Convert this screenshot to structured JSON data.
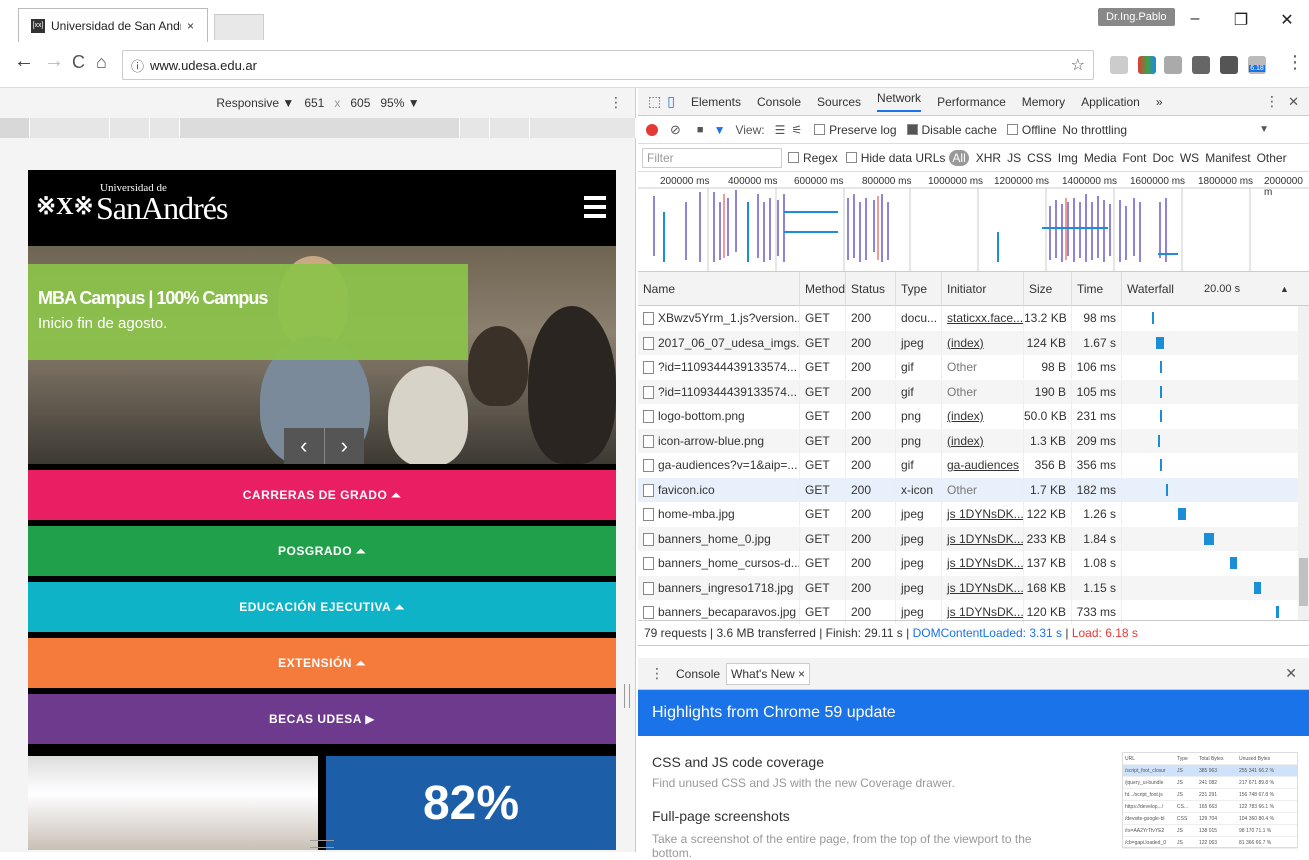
{
  "browser": {
    "tab_title": "Universidad de San Andr",
    "tab_close": "×",
    "favicon_text": "[xx]",
    "user_name": "Dr.Ing.Pablo",
    "win_min": "–",
    "win_max": "❐",
    "win_close": "✕",
    "back": "←",
    "forward": "→",
    "reload": "C",
    "home": "⌂",
    "info_icon": "ⓘ",
    "url": "www.udesa.edu.ar",
    "bookmark": "☆",
    "menu": "⋮",
    "badge": "6.18"
  },
  "emulation": {
    "mode": "Responsive ▼",
    "width": "651",
    "times": "x",
    "height": "605",
    "zoom": "95% ▼",
    "dots": "⋮"
  },
  "site": {
    "logo_small": "Universidad de",
    "logo_big": "SanAndrés",
    "logo_crest": "※X※",
    "hero_title": "MBA Campus | 100% Campus",
    "hero_sub": "Inicio fin de agosto.",
    "prev": "‹",
    "next": "›",
    "menus": [
      {
        "label": "CARRERAS DE GRADO ⏶",
        "color": "#e91e63"
      },
      {
        "label": "POSGRADO ⏶",
        "color": "#21a04b"
      },
      {
        "label": "EDUCACIÓN EJECUTIVA ⏶",
        "color": "#0fb3c8"
      },
      {
        "label": "EXTENSIÓN ⏶",
        "color": "#f47b3b"
      },
      {
        "label": "BECAS UDESA ▶",
        "color": "#6d3a8e"
      }
    ],
    "stat": "82%"
  },
  "devtools": {
    "tabs": [
      "Elements",
      "Console",
      "Sources",
      "Network",
      "Performance",
      "Memory",
      "Application",
      "»"
    ],
    "active_tab": "Network",
    "view_label": "View:",
    "preserve_log": "Preserve log",
    "disable_cache": "Disable cache",
    "offline": "Offline",
    "throttling": "No throttling",
    "filter_placeholder": "Filter",
    "regex": "Regex",
    "hide_data_urls": "Hide data URLs",
    "type_filters": [
      "All",
      "XHR",
      "JS",
      "CSS",
      "Img",
      "Media",
      "Font",
      "Doc",
      "WS",
      "Manifest",
      "Other"
    ],
    "overview_labels": [
      "200000 ms",
      "400000 ms",
      "600000 ms",
      "800000 ms",
      "1000000 ms",
      "1200000 ms",
      "1400000 ms",
      "1600000 ms",
      "1800000 ms",
      "2000000 m"
    ],
    "columns": [
      "Name",
      "Method",
      "Status",
      "Type",
      "Initiator",
      "Size",
      "Time",
      "Waterfall"
    ],
    "waterfall_scale": "20.00 s",
    "rows": [
      {
        "name": "XBwzv5Yrm_1.js?version...",
        "method": "GET",
        "status": "200",
        "type": "docu...",
        "initiator": "staticxx.face...",
        "size": "13.2 KB",
        "time": "98 ms"
      },
      {
        "name": "2017_06_07_udesa_imgs...",
        "method": "GET",
        "status": "200",
        "type": "jpeg",
        "initiator": "(index)",
        "size": "124 KB",
        "time": "1.67 s"
      },
      {
        "name": "?id=1109344439133574...",
        "method": "GET",
        "status": "200",
        "type": "gif",
        "initiator": "Other",
        "size": "98 B",
        "time": "106 ms"
      },
      {
        "name": "?id=1109344439133574...",
        "method": "GET",
        "status": "200",
        "type": "gif",
        "initiator": "Other",
        "size": "190 B",
        "time": "105 ms"
      },
      {
        "name": "logo-bottom.png",
        "method": "GET",
        "status": "200",
        "type": "png",
        "initiator": "(index)",
        "size": "50.0 KB",
        "time": "231 ms"
      },
      {
        "name": "icon-arrow-blue.png",
        "method": "GET",
        "status": "200",
        "type": "png",
        "initiator": "(index)",
        "size": "1.3 KB",
        "time": "209 ms"
      },
      {
        "name": "ga-audiences?v=1&aip=...",
        "method": "GET",
        "status": "200",
        "type": "gif",
        "initiator": "ga-audiences",
        "size": "356 B",
        "time": "356 ms"
      },
      {
        "name": "favicon.ico",
        "method": "GET",
        "status": "200",
        "type": "x-icon",
        "initiator": "Other",
        "size": "1.7 KB",
        "time": "182 ms"
      },
      {
        "name": "home-mba.jpg",
        "method": "GET",
        "status": "200",
        "type": "jpeg",
        "initiator": "js 1DYNsDK...",
        "size": "122 KB",
        "time": "1.26 s"
      },
      {
        "name": "banners_home_0.jpg",
        "method": "GET",
        "status": "200",
        "type": "jpeg",
        "initiator": "js 1DYNsDK...",
        "size": "233 KB",
        "time": "1.84 s"
      },
      {
        "name": "banners_home_cursos-d...",
        "method": "GET",
        "status": "200",
        "type": "jpeg",
        "initiator": "js 1DYNsDK...",
        "size": "137 KB",
        "time": "1.08 s"
      },
      {
        "name": "banners_ingreso1718.jpg",
        "method": "GET",
        "status": "200",
        "type": "jpeg",
        "initiator": "js 1DYNsDK...",
        "size": "168 KB",
        "time": "1.15 s"
      },
      {
        "name": "banners_becaparavos.jpg",
        "method": "GET",
        "status": "200",
        "type": "jpeg",
        "initiator": "js 1DYNsDK...",
        "size": "120 KB",
        "time": "733 ms"
      }
    ],
    "summary_a": "79 requests | 3.6 MB transferred | Finish: 29.11 s | ",
    "summary_dcl": "DOMContentLoaded: 3.31 s",
    "summary_sep": " | ",
    "summary_load": "Load: 6.18 s",
    "drawer_tabs": [
      "Console",
      "What's New ×"
    ],
    "drawer_close": "✕",
    "banner": "Highlights from Chrome 59 update",
    "features": [
      {
        "title": "CSS and JS code coverage",
        "desc": "Find unused CSS and JS with the new Coverage drawer."
      },
      {
        "title": "Full-page screenshots",
        "desc": "Take a screenshot of the entire page, from the top of the viewport to the bottom."
      }
    ],
    "coverage_head": [
      "URL",
      "Type",
      "Total Bytes",
      "Unused Bytes"
    ],
    "coverage_rows": [
      [
        "/script_foot_closur",
        "JS",
        "385 963",
        "255 341 66.2 %"
      ],
      [
        "/jquery_ui-bundle",
        "JS",
        "241 082",
        "217 671 89.8 %"
      ],
      [
        "ht.../script_foot.js",
        "JS",
        "231 291",
        "156 748 67.8 %"
      ],
      [
        "https://develop.../",
        "CS...",
        "165 663",
        "122 783 66.1 %"
      ],
      [
        "/devsite-google-bl",
        "CSS",
        "129 704",
        "104 360 80.4 %"
      ],
      [
        "/rs=AA2YrTfvYE2",
        "JS",
        "138 015",
        "98 170 71.1 %"
      ],
      [
        "/cb=gapi.loaded_0",
        "JS",
        "122 063",
        "81 366 66.7 %"
      ]
    ]
  },
  "colors": {
    "accent": "#1a73e8",
    "record": "#e53935",
    "dcl": "#1a73e8",
    "load": "#e53935",
    "waterfall": "#1a8fd8"
  }
}
